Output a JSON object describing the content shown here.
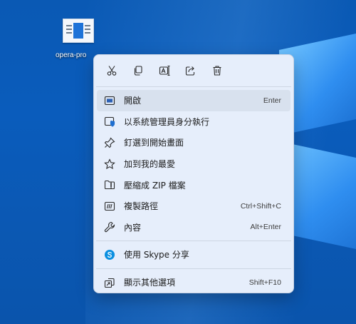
{
  "desktop": {
    "icon_label": "opera-pro",
    "accent": "#0a59b4"
  },
  "context_menu": {
    "toolbar": [
      {
        "icon": "scissors-icon",
        "tooltip": "Cut"
      },
      {
        "icon": "copy-icon",
        "tooltip": "Copy"
      },
      {
        "icon": "rename-icon",
        "tooltip": "Rename"
      },
      {
        "icon": "share-icon",
        "tooltip": "Share"
      },
      {
        "icon": "trash-icon",
        "tooltip": "Delete"
      }
    ],
    "items": [
      {
        "label": "開啟",
        "shortcut": "Enter",
        "icon": "open-window-icon"
      },
      {
        "label": "以系統管理員身分執行",
        "shortcut": "",
        "icon": "admin-shield-icon"
      },
      {
        "label": "釘選到開始畫面",
        "shortcut": "",
        "icon": "pin-icon"
      },
      {
        "label": "加到我的最愛",
        "shortcut": "",
        "icon": "star-icon"
      },
      {
        "label": "壓縮成 ZIP 檔案",
        "shortcut": "",
        "icon": "zip-folder-icon"
      },
      {
        "label": "複製路徑",
        "shortcut": "Ctrl+Shift+C",
        "icon": "copy-path-icon"
      },
      {
        "label": "內容",
        "shortcut": "Alt+Enter",
        "icon": "wrench-icon"
      },
      {
        "label": "使用 Skype 分享",
        "shortcut": "",
        "icon": "skype-icon"
      },
      {
        "label": "顯示其他選項",
        "shortcut": "Shift+F10",
        "icon": "more-options-icon"
      }
    ]
  }
}
